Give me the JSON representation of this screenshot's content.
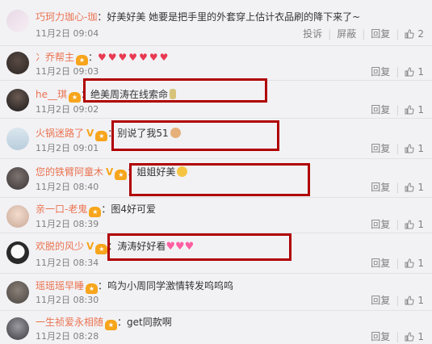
{
  "comments": [
    {
      "user": "巧珂力珈心-珈",
      "badge": "",
      "verified": false,
      "sep": "：",
      "text": "好美好美 她要是把手里的外套穿上估计衣品刷的降下来了~",
      "time": "11月2日 09:04",
      "report": "投诉",
      "block": "屏蔽",
      "reply": "回复",
      "likes": "2"
    },
    {
      "user": "冫乔帮主",
      "badge": "★",
      "verified": false,
      "sep": "：",
      "text": "",
      "hearts": "♥♥♥♥♥♥♥",
      "time": "11月2日 09:03",
      "reply": "回复",
      "likes": "1"
    },
    {
      "user": "he__琪",
      "badge": "★",
      "verified": false,
      "sep": "：",
      "text": "绝美周涛在线索命",
      "time": "11月2日 09:02",
      "reply": "回复",
      "likes": "1"
    },
    {
      "user": "火锅迷路了",
      "badge": "★",
      "verified": true,
      "sep": "：",
      "text": "别说了我51",
      "time": "11月2日 09:01",
      "reply": "回复",
      "likes": "1"
    },
    {
      "user": "您的铁臂阿童木",
      "badge": "★",
      "verified": true,
      "sep": "：",
      "text": "姐姐好美",
      "time": "11月2日 08:40",
      "reply": "回复",
      "likes": "1"
    },
    {
      "user": "亲一口-老鬼",
      "badge": "★",
      "verified": false,
      "sep": "：",
      "text": "图4好可爱",
      "time": "11月2日 08:39",
      "reply": "回复",
      "likes": "1"
    },
    {
      "user": "欢脱的风少",
      "badge": "★",
      "verified": true,
      "sep": "：",
      "text": "涛涛好好看",
      "hearts": "♥♥♥",
      "time": "11月2日 08:34",
      "reply": "回复",
      "likes": "1"
    },
    {
      "user": "瑶瑶瑶早睡",
      "badge": "★",
      "verified": false,
      "sep": "：",
      "text": "呜为小周同学激情转发呜呜呜",
      "time": "11月2日 08:30",
      "reply": "回复",
      "likes": "1"
    },
    {
      "user": "一生祯爱永相随",
      "badge": "★",
      "verified": false,
      "sep": "：",
      "text": "get同款啊",
      "time": "11月2日 08:28",
      "reply": "回复",
      "likes": "1"
    }
  ],
  "colors": {
    "username": "#eb7350",
    "annotation_box": "#b00000",
    "background": "#f2f2f5"
  }
}
